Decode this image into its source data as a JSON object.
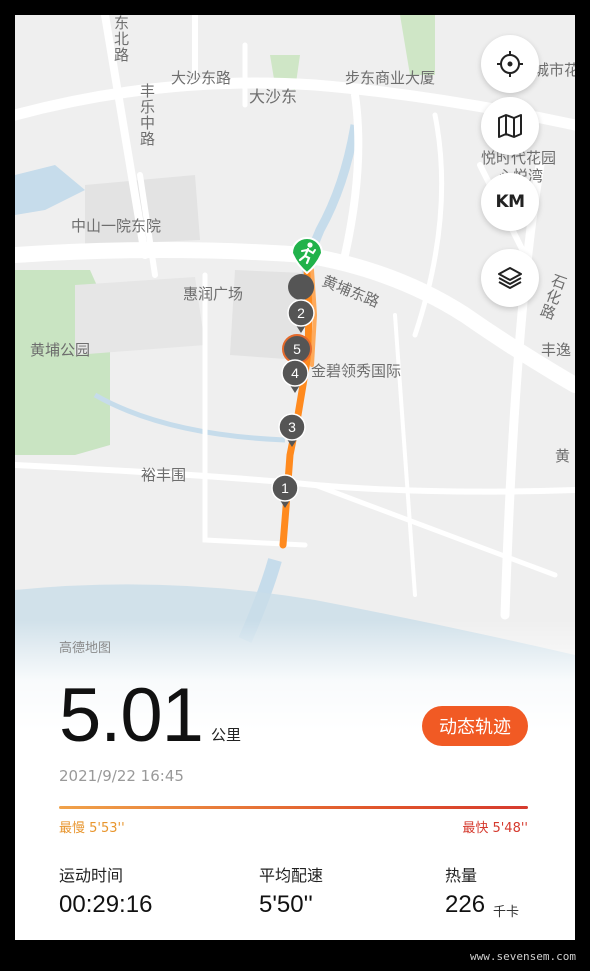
{
  "map": {
    "labels": {
      "dashadong_road": "大沙东路",
      "dashadong": "大沙东",
      "budong_building": "步东商业大厦",
      "huangpu_east_road": "黄埔东路",
      "zhongshan_hospital": "中山一院东院",
      "huirun_plaza": "惠润广场",
      "huangpu_park": "黄埔公园",
      "jinbi": "金碧领秀国际",
      "yufengwei": "裕丰围",
      "fengle_middle_road": "丰乐中路",
      "dongbei_road": "东北路",
      "yueshi_garden": "悦时代花园",
      "yuehu_wan": "心悦湾",
      "chengshi": "城市花",
      "shihua_road": "石化路",
      "fengyi": "丰逸",
      "huang": "黄"
    },
    "markers": [
      "1",
      "2",
      "3",
      "4",
      "5"
    ],
    "route_color": "#ff8a1e",
    "start_color": "#21b24b"
  },
  "controls": {
    "locate_icon": "crosshair-icon",
    "map_icon": "map-icon",
    "km_label": "KM",
    "layers_icon": "layers-icon"
  },
  "summary": {
    "provider": "高德地图",
    "distance": "5.01",
    "distance_unit": "公里",
    "dynamic_track_label": "动态轨迹",
    "datetime": "2021/9/22 16:45",
    "slowest": "最慢 5'53''",
    "fastest": "最快 5'48''",
    "accent_color": "#f15a24"
  },
  "stats": [
    {
      "label": "运动时间",
      "value": "00:29:16",
      "unit": ""
    },
    {
      "label": "平均配速",
      "value": "5'50''",
      "unit": ""
    },
    {
      "label": "热量",
      "value": "226",
      "unit": "千卡"
    }
  ],
  "watermark": "www.sevensem.com"
}
